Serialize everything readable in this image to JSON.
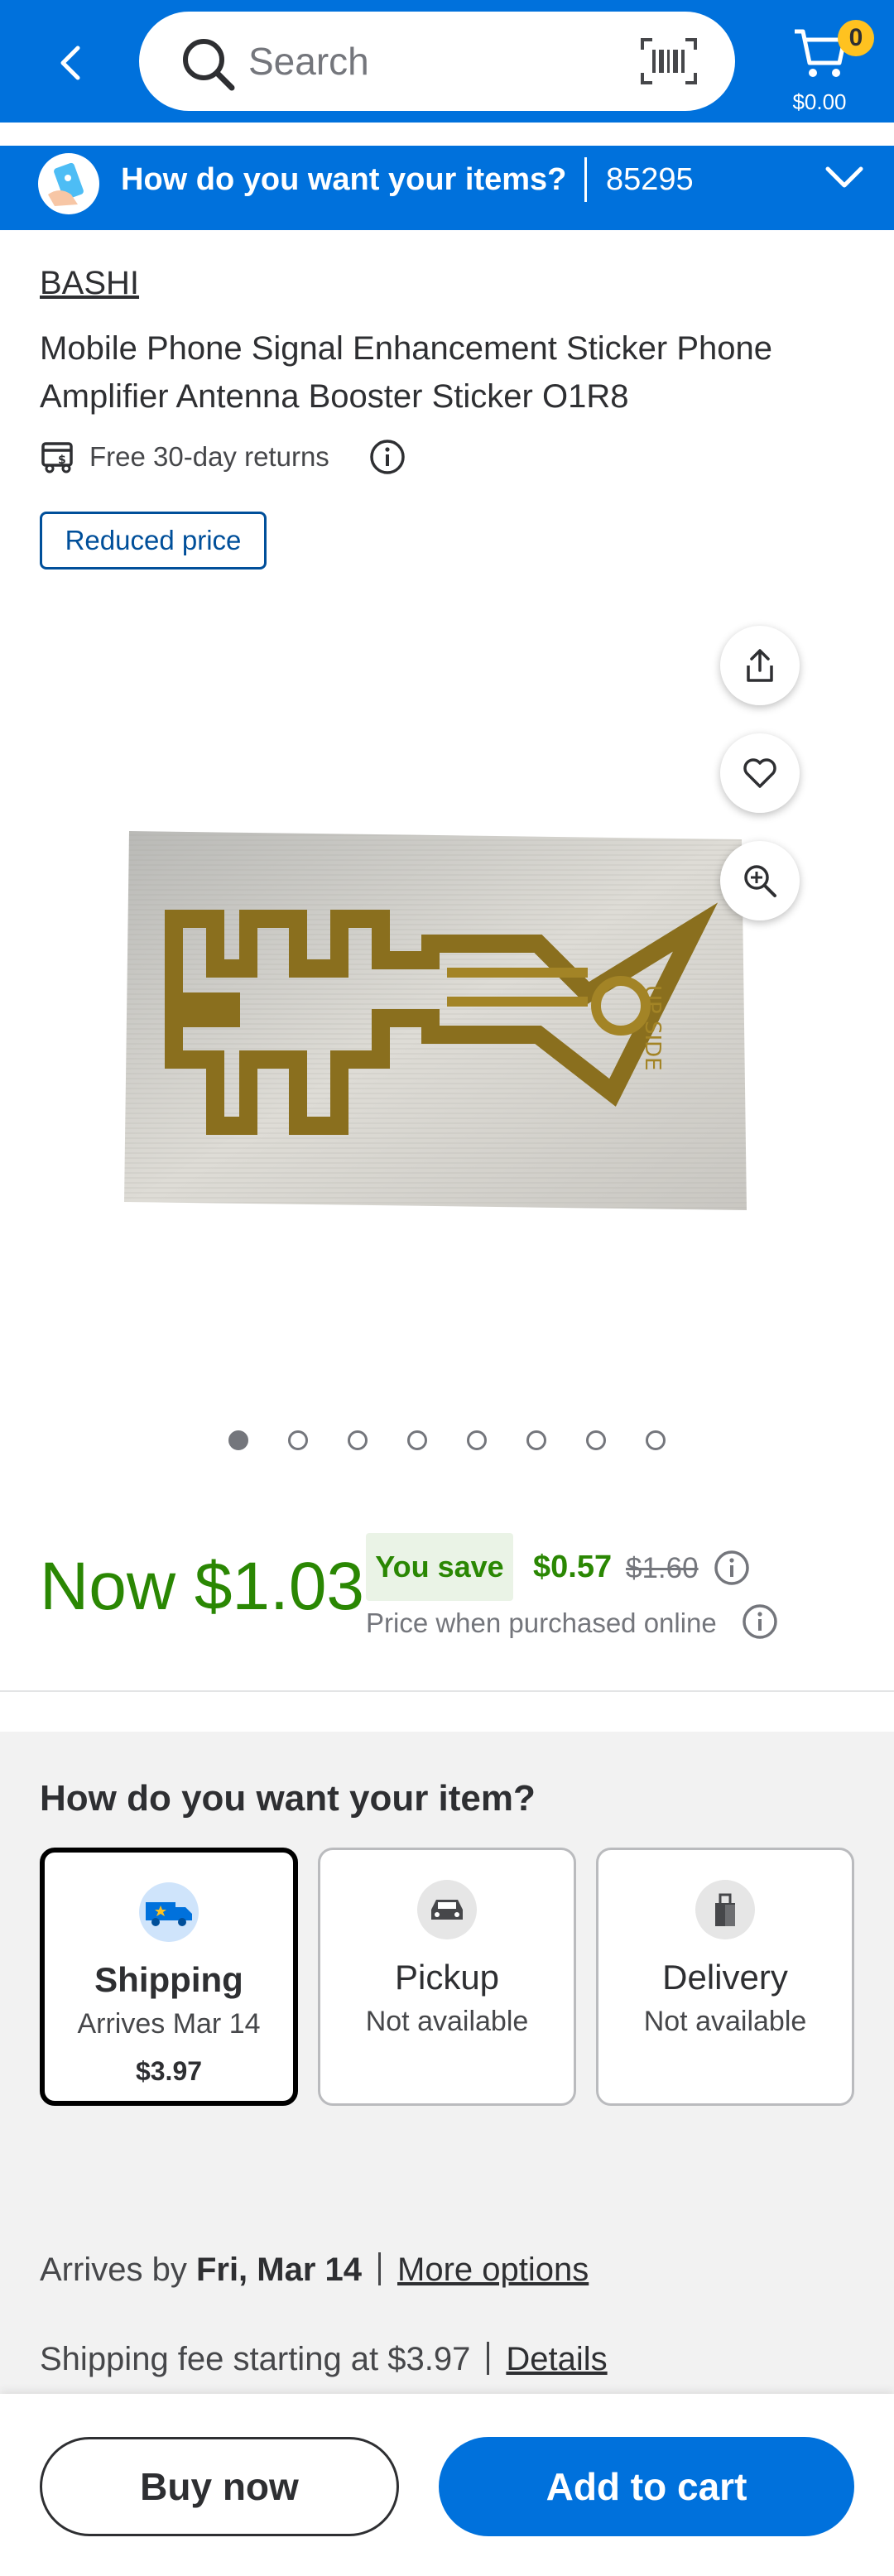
{
  "header": {
    "search_placeholder": "Search",
    "cart_count": "0",
    "cart_total": "$0.00"
  },
  "fulfillment_bar": {
    "question": "How do you want your items?",
    "zip": "85295"
  },
  "product": {
    "brand": "BASHI",
    "title": "Mobile Phone Signal Enhancement Sticker Phone Amplifier Antenna Booster Sticker O1R8",
    "returns": "Free 30-day returns",
    "badge": "Reduced price",
    "image_count": 8,
    "active_image": 1
  },
  "price": {
    "now": "Now $1.03",
    "you_save_label": "You save",
    "save_amount": "$0.57",
    "was_price": "$1.60",
    "note": "Price when purchased online"
  },
  "fulfillment": {
    "title": "How do you want your item?",
    "options": [
      {
        "name": "Shipping",
        "sub": "Arrives Mar 14",
        "price": "$3.97"
      },
      {
        "name": "Pickup",
        "sub": "Not available"
      },
      {
        "name": "Delivery",
        "sub": "Not available"
      }
    ],
    "arrives_prefix": "Arrives by",
    "arrives_date": "Fri, Mar 14",
    "more_options": "More options",
    "fee_text": "Shipping fee starting at $3.97",
    "details": "Details"
  },
  "actions": {
    "buy_now": "Buy now",
    "add_to_cart": "Add to cart"
  },
  "colors": {
    "brand_blue": "#0071dc",
    "price_green": "#2a8703",
    "badge_yellow": "#ffc220"
  }
}
